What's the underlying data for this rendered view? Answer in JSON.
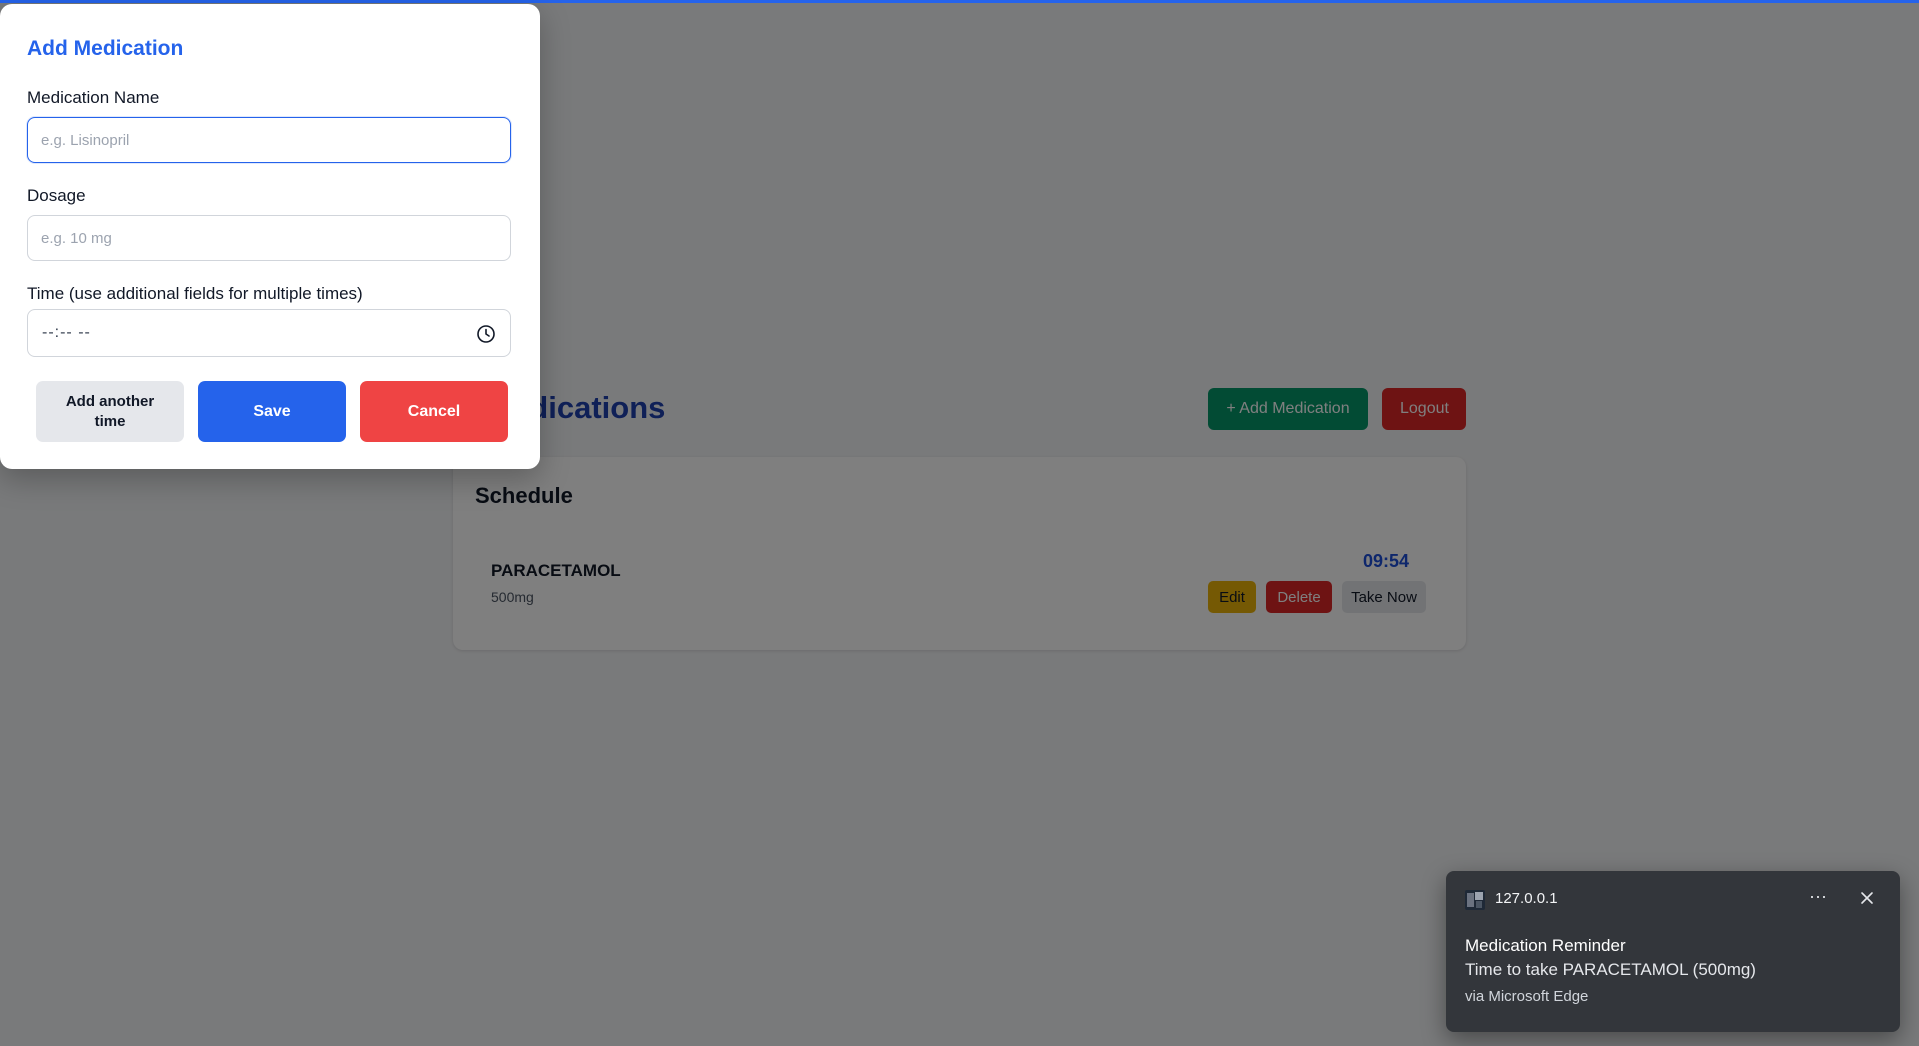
{
  "page": {
    "title": "'s Medications",
    "add_button": "+ Add Medication",
    "logout_button": "Logout"
  },
  "schedule": {
    "title": "Schedule",
    "items": [
      {
        "name": "PARACETAMOL",
        "dosage": "500mg",
        "time": "09:54",
        "edit": "Edit",
        "delete": "Delete",
        "take": "Take Now"
      }
    ]
  },
  "modal": {
    "title": "Add Medication",
    "name_label": "Medication Name",
    "name_placeholder": "e.g. Lisinopril",
    "dosage_label": "Dosage",
    "dosage_placeholder": "e.g. 10 mg",
    "time_label": "Time (use additional fields for multiple times)",
    "time_value": "--:-- --",
    "add_time_button": "Add another time",
    "save_button": "Save",
    "cancel_button": "Cancel"
  },
  "notification": {
    "host": "127.0.0.1",
    "more_icon": "ellipsis-icon",
    "title": "Medication Reminder",
    "body": "Time to take PARACETAMOL (500mg)",
    "source": "via Microsoft Edge"
  },
  "colors": {
    "primary": "#2563eb",
    "success": "#059669",
    "danger": "#dc2626",
    "warning": "#eab308"
  }
}
